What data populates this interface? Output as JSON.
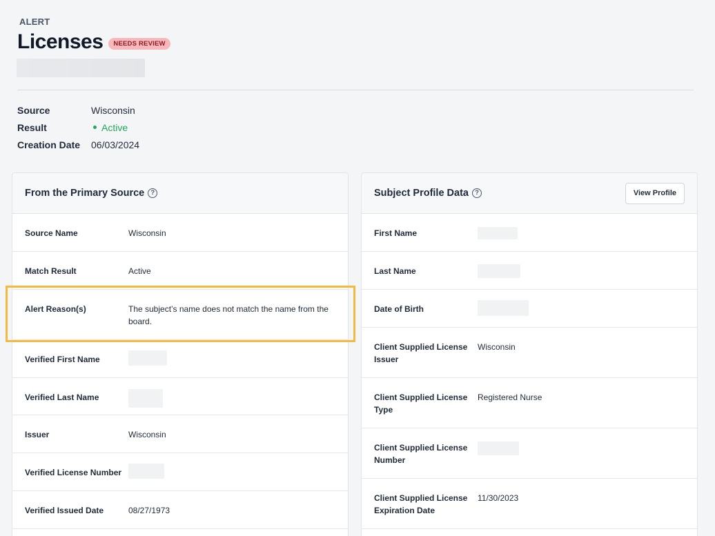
{
  "header": {
    "eyebrow": "ALERT",
    "title": "Licenses",
    "badge": "NEEDS REVIEW"
  },
  "meta": [
    {
      "key": "Source",
      "value": "Wisconsin"
    },
    {
      "key": "Result",
      "value": "Active"
    },
    {
      "key": "Creation Date",
      "value": "06/03/2024"
    }
  ],
  "primary_source": {
    "title": "From the Primary Source",
    "rows": [
      {
        "key": "Source Name",
        "value": "Wisconsin"
      },
      {
        "key": "Match Result",
        "value": "Active"
      },
      {
        "key": "Alert Reason(s)",
        "value": "The subject’s name does not match the name from the board."
      },
      {
        "key": "Verified First Name",
        "value": ""
      },
      {
        "key": "Verified Last Name",
        "value": ""
      },
      {
        "key": "Issuer",
        "value": "Wisconsin"
      },
      {
        "key": "Verified License Number",
        "value": ""
      },
      {
        "key": "Verified Issued Date",
        "value": "08/27/1973"
      }
    ]
  },
  "subject_profile": {
    "title": "Subject Profile Data",
    "view_profile_label": "View Profile",
    "rows": [
      {
        "key": "First Name",
        "value": ""
      },
      {
        "key": "Last Name",
        "value": ""
      },
      {
        "key": "Date of Birth",
        "value": ""
      },
      {
        "key": "Client Supplied License Issuer",
        "value": "Wisconsin"
      },
      {
        "key": "Client Supplied License Type",
        "value": "Registered Nurse"
      },
      {
        "key": "Client Supplied License Number",
        "value": ""
      },
      {
        "key": "Client Supplied License Expiration Date",
        "value": "11/30/2023"
      }
    ]
  },
  "colors": {
    "active": "#22a85a",
    "badge_bg": "#f7b7bb",
    "highlight": "#f5b942"
  }
}
